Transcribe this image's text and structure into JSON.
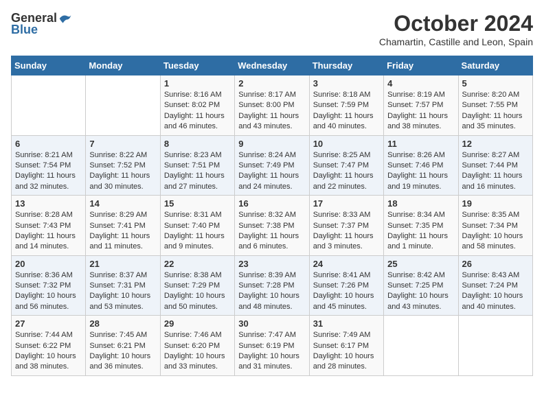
{
  "header": {
    "logo_general": "General",
    "logo_blue": "Blue",
    "month_title": "October 2024",
    "location": "Chamartin, Castille and Leon, Spain"
  },
  "days_of_week": [
    "Sunday",
    "Monday",
    "Tuesday",
    "Wednesday",
    "Thursday",
    "Friday",
    "Saturday"
  ],
  "weeks": [
    [
      {
        "day": "",
        "info": ""
      },
      {
        "day": "",
        "info": ""
      },
      {
        "day": "1",
        "info": "Sunrise: 8:16 AM\nSunset: 8:02 PM\nDaylight: 11 hours and 46 minutes."
      },
      {
        "day": "2",
        "info": "Sunrise: 8:17 AM\nSunset: 8:00 PM\nDaylight: 11 hours and 43 minutes."
      },
      {
        "day": "3",
        "info": "Sunrise: 8:18 AM\nSunset: 7:59 PM\nDaylight: 11 hours and 40 minutes."
      },
      {
        "day": "4",
        "info": "Sunrise: 8:19 AM\nSunset: 7:57 PM\nDaylight: 11 hours and 38 minutes."
      },
      {
        "day": "5",
        "info": "Sunrise: 8:20 AM\nSunset: 7:55 PM\nDaylight: 11 hours and 35 minutes."
      }
    ],
    [
      {
        "day": "6",
        "info": "Sunrise: 8:21 AM\nSunset: 7:54 PM\nDaylight: 11 hours and 32 minutes."
      },
      {
        "day": "7",
        "info": "Sunrise: 8:22 AM\nSunset: 7:52 PM\nDaylight: 11 hours and 30 minutes."
      },
      {
        "day": "8",
        "info": "Sunrise: 8:23 AM\nSunset: 7:51 PM\nDaylight: 11 hours and 27 minutes."
      },
      {
        "day": "9",
        "info": "Sunrise: 8:24 AM\nSunset: 7:49 PM\nDaylight: 11 hours and 24 minutes."
      },
      {
        "day": "10",
        "info": "Sunrise: 8:25 AM\nSunset: 7:47 PM\nDaylight: 11 hours and 22 minutes."
      },
      {
        "day": "11",
        "info": "Sunrise: 8:26 AM\nSunset: 7:46 PM\nDaylight: 11 hours and 19 minutes."
      },
      {
        "day": "12",
        "info": "Sunrise: 8:27 AM\nSunset: 7:44 PM\nDaylight: 11 hours and 16 minutes."
      }
    ],
    [
      {
        "day": "13",
        "info": "Sunrise: 8:28 AM\nSunset: 7:43 PM\nDaylight: 11 hours and 14 minutes."
      },
      {
        "day": "14",
        "info": "Sunrise: 8:29 AM\nSunset: 7:41 PM\nDaylight: 11 hours and 11 minutes."
      },
      {
        "day": "15",
        "info": "Sunrise: 8:31 AM\nSunset: 7:40 PM\nDaylight: 11 hours and 9 minutes."
      },
      {
        "day": "16",
        "info": "Sunrise: 8:32 AM\nSunset: 7:38 PM\nDaylight: 11 hours and 6 minutes."
      },
      {
        "day": "17",
        "info": "Sunrise: 8:33 AM\nSunset: 7:37 PM\nDaylight: 11 hours and 3 minutes."
      },
      {
        "day": "18",
        "info": "Sunrise: 8:34 AM\nSunset: 7:35 PM\nDaylight: 11 hours and 1 minute."
      },
      {
        "day": "19",
        "info": "Sunrise: 8:35 AM\nSunset: 7:34 PM\nDaylight: 10 hours and 58 minutes."
      }
    ],
    [
      {
        "day": "20",
        "info": "Sunrise: 8:36 AM\nSunset: 7:32 PM\nDaylight: 10 hours and 56 minutes."
      },
      {
        "day": "21",
        "info": "Sunrise: 8:37 AM\nSunset: 7:31 PM\nDaylight: 10 hours and 53 minutes."
      },
      {
        "day": "22",
        "info": "Sunrise: 8:38 AM\nSunset: 7:29 PM\nDaylight: 10 hours and 50 minutes."
      },
      {
        "day": "23",
        "info": "Sunrise: 8:39 AM\nSunset: 7:28 PM\nDaylight: 10 hours and 48 minutes."
      },
      {
        "day": "24",
        "info": "Sunrise: 8:41 AM\nSunset: 7:26 PM\nDaylight: 10 hours and 45 minutes."
      },
      {
        "day": "25",
        "info": "Sunrise: 8:42 AM\nSunset: 7:25 PM\nDaylight: 10 hours and 43 minutes."
      },
      {
        "day": "26",
        "info": "Sunrise: 8:43 AM\nSunset: 7:24 PM\nDaylight: 10 hours and 40 minutes."
      }
    ],
    [
      {
        "day": "27",
        "info": "Sunrise: 7:44 AM\nSunset: 6:22 PM\nDaylight: 10 hours and 38 minutes."
      },
      {
        "day": "28",
        "info": "Sunrise: 7:45 AM\nSunset: 6:21 PM\nDaylight: 10 hours and 36 minutes."
      },
      {
        "day": "29",
        "info": "Sunrise: 7:46 AM\nSunset: 6:20 PM\nDaylight: 10 hours and 33 minutes."
      },
      {
        "day": "30",
        "info": "Sunrise: 7:47 AM\nSunset: 6:19 PM\nDaylight: 10 hours and 31 minutes."
      },
      {
        "day": "31",
        "info": "Sunrise: 7:49 AM\nSunset: 6:17 PM\nDaylight: 10 hours and 28 minutes."
      },
      {
        "day": "",
        "info": ""
      },
      {
        "day": "",
        "info": ""
      }
    ]
  ]
}
